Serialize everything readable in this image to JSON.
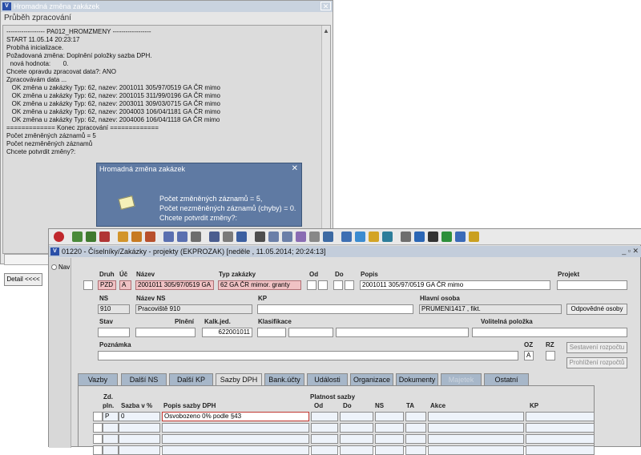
{
  "bg_window": {
    "title": "Hromadná změna zakázek",
    "section_label": "Průběh zpracování",
    "log_lines": [
      "------------------ PA012_HROMZMENY ------------------",
      "START 11.05.14 20:23:17",
      "Probíhá inicializace.",
      "Požadovaná změna: Doplnění položky sazba DPH.",
      "  nová hodnota:       0.",
      "Chcete opravdu zpracovat data?: ANO",
      "Zpracovávám data ...",
      "   OK změna u zakázky Typ: 62, nazev: 2001011 305/97/0519 GA ČR mimo",
      "   OK změna u zakázky Typ: 62, nazev: 2001015 311/99/0196 GA ČR mimo",
      "   OK změna u zakázky Typ: 62, nazev: 2003011 309/03/0715 GA ČR mimo",
      "   OK změna u zakázky Typ: 62, nazev: 2004003 106/04/1181 GA ČR mimo",
      "   OK změna u zakázky Typ: 62, nazev: 2004006 106/04/1118 GA ČR mimo",
      "============= Konec zpracování =============",
      "",
      "Počet změněných záznamů = 5",
      "Počet nezměněných záznamů",
      "Chcete potvrdit změny?:"
    ],
    "detail_button": "Detail <<<<"
  },
  "dialog": {
    "title": "Hromadná změna zakázek",
    "close": "✕",
    "messages": [
      "Počet změněných záznamů = 5,",
      "Počet nezměněných záznamů (chyby) = 0.",
      "Chcete potvrdit změny?:"
    ]
  },
  "toolbar_icons": [
    "exit-icon",
    "add-record-icon",
    "copy-record-icon",
    "delete-record-icon",
    "find-icon",
    "find-next-icon",
    "find-prev-icon",
    "sort-asc-icon",
    "sort-desc-icon",
    "filter-icon",
    "print-icon",
    "print-preview-icon",
    "export-icon",
    "cut-icon",
    "copy-icon",
    "paste-icon",
    "spell-icon",
    "columns-icon",
    "calendar-icon",
    "home-icon",
    "globe-icon",
    "star-icon",
    "triangle-icon",
    "attach-icon",
    "chart-icon",
    "sum-icon",
    "excel-icon",
    "info-icon",
    "help-icon"
  ],
  "front_window": {
    "title": "01220 - Číselníky/Zakázky - projekty (EKPROZAK) [neděle , 11.05.2014; 20:24:13]",
    "controls": "_ ▫ ✕"
  },
  "nav": {
    "label": "Nav"
  },
  "form": {
    "labels": {
      "druh": "Druh",
      "uc": "Úč",
      "nazev": "Název",
      "typ_zakazky": "Typ zakázky",
      "od": "Od",
      "do": "Do",
      "popis": "Popis",
      "projekt": "Projekt",
      "ns": "NS",
      "nazev_ns": "Název NS",
      "kp": "KP",
      "hlavni_osoba": "Hlavní osoba",
      "stav": "Stav",
      "plneni": "Plnění",
      "kalk_jed": "Kalk.jed.",
      "klasifikace": "Klasifikace",
      "volitelna_polozka": "Volitelná položka",
      "poznamka": "Poznámka",
      "oz": "OZ",
      "rz": "RZ"
    },
    "values": {
      "druh": "PZD",
      "uc": "A",
      "nazev": "2001011 305/97/0519 GA",
      "typ_zakazky": "62 GA ČR mimor. granty",
      "popis": "2001011 305/97/0519 GA ČR mimo",
      "ns": "910",
      "nazev_ns": "Pracoviště 910",
      "hlavni_osoba": "PRUMENI1417 , fikt.",
      "kalk_jed": "622001011",
      "oz": "A"
    },
    "buttons": {
      "odpovedne_osoby": "Odpovědné osoby",
      "sestaveni_rozpoctu": "Sestavení rozpočtu",
      "prohlizeni_rozpoctu": "Prohlížení rozpočtů"
    }
  },
  "tabs": [
    "Vazby",
    "Další NS",
    "Další KP",
    "Sazby DPH",
    "Bank.účty",
    "Události",
    "Organizace",
    "Dokumenty",
    "Majetek",
    "Ostatní"
  ],
  "active_tab": "Sazby DPH",
  "grid": {
    "headers": {
      "zd_top": "Zd.",
      "zd_bottom": "pln.",
      "sazba": "Sazba v %",
      "popis": "Popis sazby DPH",
      "platnost": "Platnost sazby",
      "od": "Od",
      "do": "Do",
      "ns": "NS",
      "ta": "TA",
      "akce": "Akce",
      "kp": "KP"
    },
    "rows": [
      {
        "zd": "P",
        "sazba": "0",
        "popis": "Osvobozeno 0% podle §43"
      }
    ]
  }
}
